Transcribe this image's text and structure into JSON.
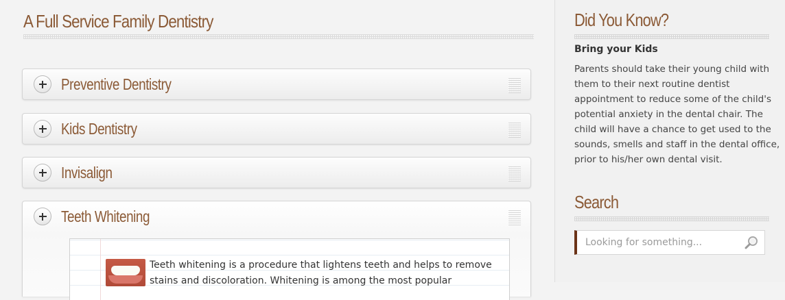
{
  "main": {
    "title": "A Full Service Family Dentistry",
    "accordion": [
      {
        "label": "Preventive Dentistry"
      },
      {
        "label": "Kids Dentistry"
      },
      {
        "label": "Invisalign"
      },
      {
        "label": "Teeth Whitening",
        "content": "Teeth whitening is a procedure that lightens teeth and helps to remove stains and discoloration. Whitening is among the most popular"
      }
    ]
  },
  "sidebar": {
    "did_you_know": {
      "title": "Did You Know?",
      "heading": "Bring your Kids",
      "body": "Parents should take their young child with them to their next routine dentist appointment to reduce some of the child's potential anxiety in the dental chair. The child will have a chance to get used to the sounds, smells and staff in the dental office, prior to his/her own dental visit."
    },
    "search": {
      "title": "Search",
      "placeholder": "Looking for something...",
      "icon": "magnifier-icon"
    }
  },
  "colors": {
    "accent_brown": "#8b5a36",
    "search_border": "#6b3318"
  }
}
